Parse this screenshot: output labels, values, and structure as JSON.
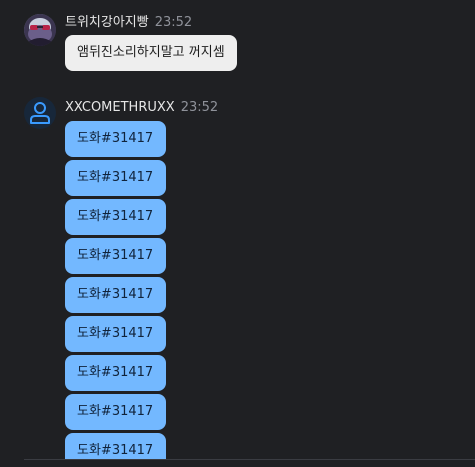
{
  "messages": [
    {
      "sender": "트위치강아지빵",
      "time": "23:52",
      "bubbles": [
        "앰뒤진소리하지말고 꺼지셈"
      ]
    },
    {
      "sender": "XXCOMETHRUXX",
      "time": "23:52",
      "bubbles": [
        "도화#31417",
        "도화#31417",
        "도화#31417",
        "도화#31417",
        "도화#31417",
        "도화#31417",
        "도화#31417",
        "도화#31417",
        "도화#31417"
      ]
    }
  ],
  "colors": {
    "background": "#1f2023",
    "incoming_bubble": "#eeeeee",
    "outgoing_bubble": "#73b8ff",
    "user_icon": "#3a9bff"
  },
  "icons": {
    "avatar_1": "profile-picture",
    "avatar_2": "user-icon"
  }
}
